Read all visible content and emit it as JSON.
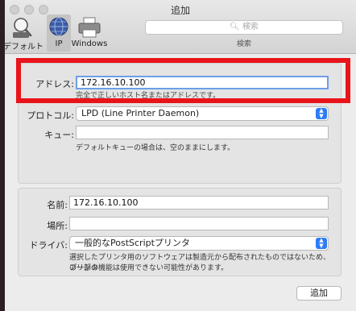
{
  "window": {
    "title": "追加"
  },
  "toolbar": {
    "items": [
      {
        "label": "デフォルト",
        "icon": "default-printer-icon"
      },
      {
        "label": "IP",
        "icon": "globe-icon"
      },
      {
        "label": "Windows",
        "icon": "windows-printer-icon"
      }
    ],
    "selected": "IP",
    "search_placeholder": "検索",
    "search_caption": "検索"
  },
  "ip_section": {
    "address_label": "アドレス:",
    "address_value": "172.16.10.100",
    "address_hint": "完全で正しいホスト名またはアドレスです。",
    "protocol_label": "プロトコル:",
    "protocol_value": "LPD (Line Printer Daemon)",
    "queue_label": "キュー:",
    "queue_value": "",
    "queue_hint": "デフォルトキューの場合は、空のままにします。"
  },
  "printer_section": {
    "name_label": "名前:",
    "name_value": "172.16.10.100",
    "location_label": "場所:",
    "location_value": "",
    "driver_label": "ドライバ:",
    "driver_value": "一般的なPostScriptプリンタ",
    "driver_hint_line1": "選択したプリンタ用のソフトウェアは製造元から配布されたものではないため、プリンタ",
    "driver_hint_line2": "の一部の機能は使用できない可能性があります。"
  },
  "footer": {
    "add_label": "追加"
  },
  "colors": {
    "highlight": "#e8141a",
    "accent": "#2d7cf6"
  }
}
